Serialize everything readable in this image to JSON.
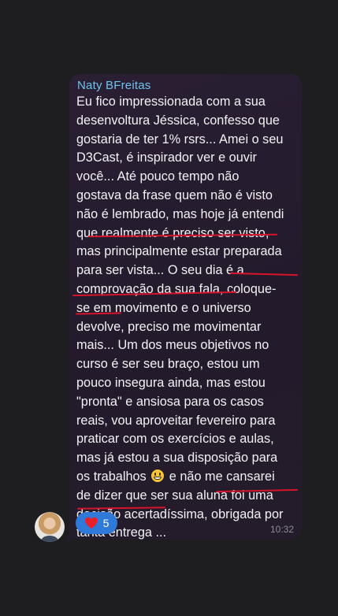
{
  "message": {
    "sender": "Naty BFreitas",
    "lines": [
      "Eu fico impressionada com a sua",
      "desenvoltura Jéssica, confesso que",
      "gostaria de ter 1% rsrs... Amei o seu",
      "D3Cast, é inspirador ver e ouvir",
      "você... Até pouco tempo não",
      "gostava da frase quem não é visto",
      "não é lembrado, mas hoje já entendi",
      "que realmente é preciso ser visto,",
      "mas principalmente estar preparada",
      "para ser vista... O seu dia é a",
      "comprovação da sua fala, coloque-",
      "se em movimento e o universo",
      "devolve, preciso me movimentar",
      "mais... Um dos meus objetivos no",
      "curso é  ser seu braço, estou um",
      "pouco insegura ainda, mas estou",
      "\"pronta\" e ansiosa para os casos",
      "reais, vou aproveitar fevereiro para",
      "praticar com os exercícios e aulas,",
      "mas já estou a sua disposição para"
    ],
    "emoji_line_before": "os trabalhos",
    "emoji_line_after": "e não me cansarei",
    "emoji_icon": "grinning-face-emoji",
    "lines_end": [
      "de dizer que ser sua aluna foi uma",
      "decisão acertadíssima, obrigada por",
      "tanta entrega ..."
    ],
    "time": "10:32",
    "reaction": {
      "icon": "heart-icon",
      "count": "5"
    }
  },
  "colors": {
    "sender": "#6fc3ef",
    "reaction_bg": "#2f7ad9",
    "heart": "#e8202c",
    "underline": "#d6142a"
  }
}
